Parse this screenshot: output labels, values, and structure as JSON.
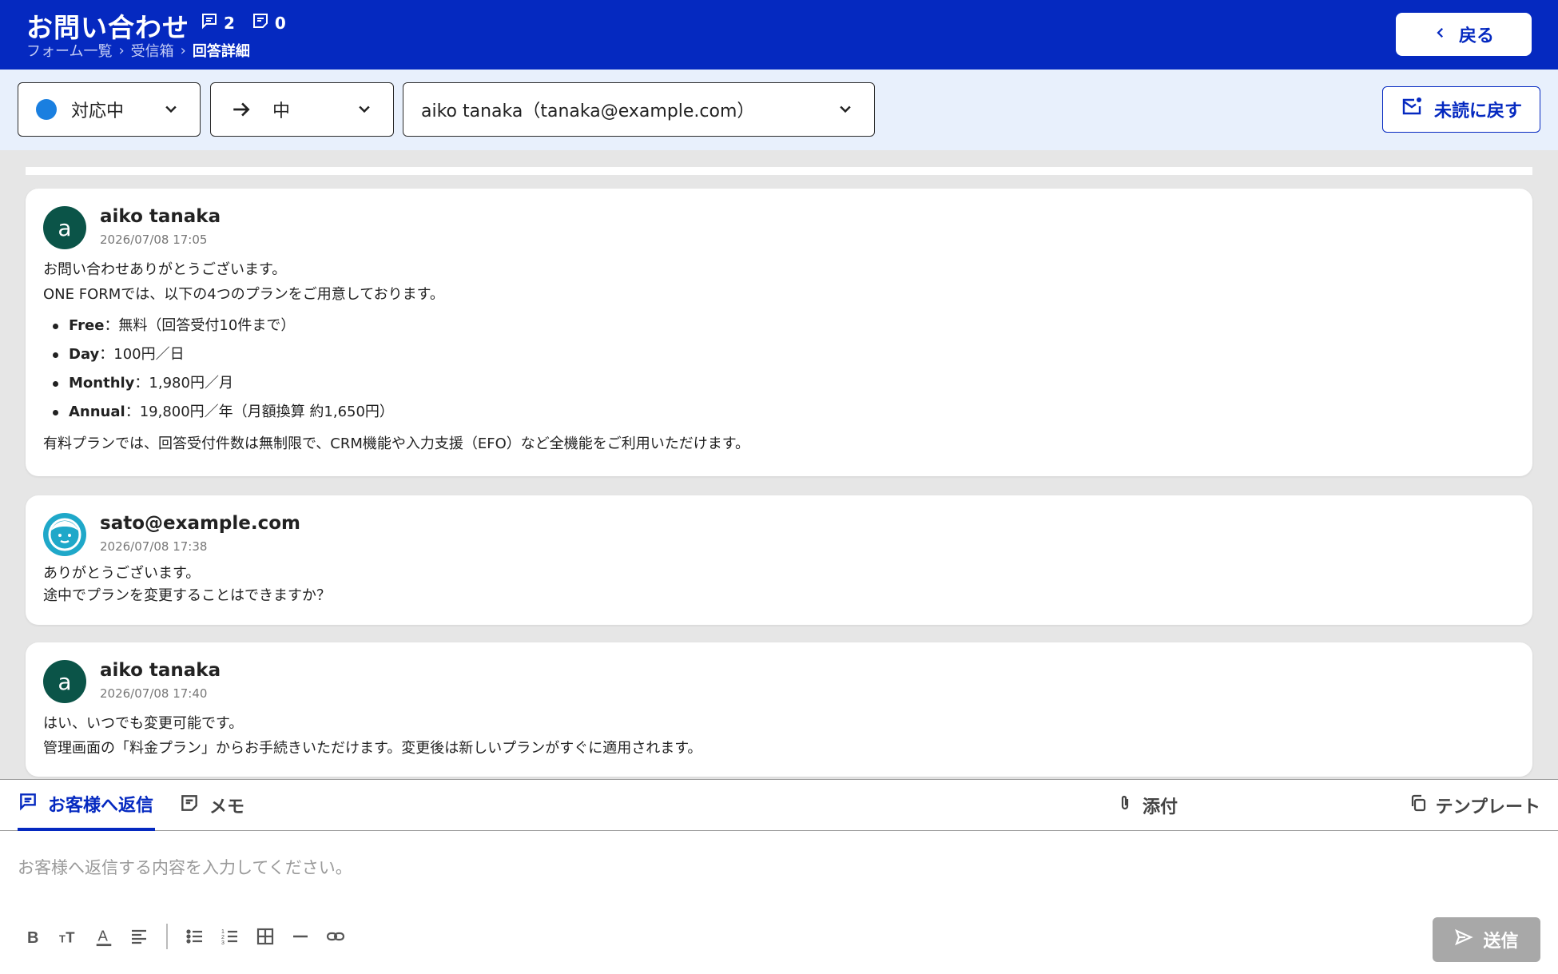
{
  "header": {
    "title": "お問い合わせ",
    "comment_count": "2",
    "memo_count": "0",
    "back_label": "戻る",
    "colors": {
      "bg": "#0529c0"
    }
  },
  "breadcrumb": {
    "items": [
      "フォーム一覧",
      "受信箱",
      "回答詳細"
    ]
  },
  "toolbar": {
    "status_value": "対応中",
    "priority_value": "中",
    "assignee_value": "aiko tanaka（tanaka@example.com）",
    "unread_label": "未読に戻す"
  },
  "messages": [
    {
      "name": "aiko tanaka",
      "avatar": "a",
      "date": "2026/07/08 17:05",
      "line1": "お問い合わせありがとうございます。",
      "line2": "ONE FORMでは、以下の4つのプランをご用意しております。",
      "plans": [
        {
          "name": "Free",
          "desc": "：無料（回答受付10件まで）"
        },
        {
          "name": "Day",
          "desc": "：100円／日"
        },
        {
          "name": "Monthly",
          "desc": "：1,980円／月"
        },
        {
          "name": "Annual",
          "desc": "：19,800円／年（月額換算 約1,650円）"
        }
      ],
      "line3": "有料プランでは、回答受付件数は無制限で、CRM機能や入力支援（EFO）など全機能をご利用いただけます。"
    },
    {
      "name": "sato@example.com",
      "date": "2026/07/08 17:38",
      "line1": "ありがとうございます。",
      "line2": "途中でプランを変更することはできますか？"
    },
    {
      "name": "aiko tanaka",
      "avatar": "a",
      "date": "2026/07/08 17:40",
      "line1": "はい、いつでも変更可能です。",
      "line2": "管理画面の「料金プラン」からお手続きいただけます。変更後は新しいプランがすぐに適用されます。"
    }
  ],
  "reply": {
    "tab_reply": "お客様へ返信",
    "tab_memo": "メモ",
    "attach_label": "添付",
    "template_label": "テンプレート",
    "placeholder": "お客様へ返信する内容を入力してください。",
    "send_label": "送信"
  }
}
